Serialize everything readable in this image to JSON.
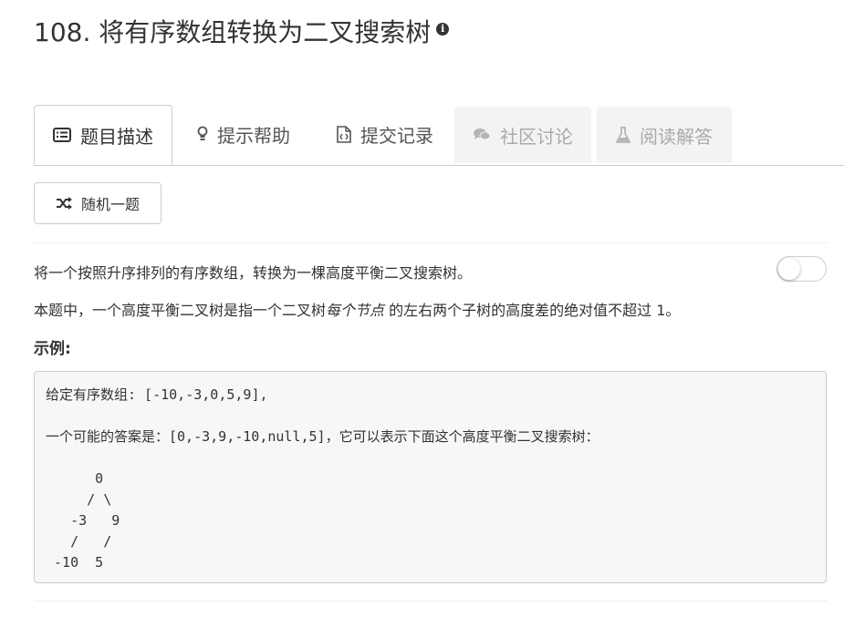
{
  "problem": {
    "title": "108. 将有序数组转换为二叉搜索树",
    "info_icon": "info-circle-icon"
  },
  "tabs": [
    {
      "label": "题目描述",
      "icon": "list-alt-icon",
      "state": "active"
    },
    {
      "label": "提示帮助",
      "icon": "lightbulb-icon",
      "state": "normal"
    },
    {
      "label": "提交记录",
      "icon": "file-code-icon",
      "state": "normal"
    },
    {
      "label": "社区讨论",
      "icon": "comments-icon",
      "state": "disabled"
    },
    {
      "label": "阅读解答",
      "icon": "flask-icon",
      "state": "disabled"
    }
  ],
  "random_button": {
    "label": "随机一题",
    "icon": "shuffle-icon"
  },
  "description": {
    "line1": "将一个按照升序排列的有序数组，转换为一棵高度平衡二叉搜索树。",
    "line2_prefix": "本题中，一个高度平衡二叉树是指一个二叉树",
    "line2_em": "每个节点",
    "line2_suffix": " 的左右两个子树的高度差的绝对值不超过 1。"
  },
  "toggle": {
    "on": false
  },
  "example": {
    "label": "示例:",
    "code": "给定有序数组: [-10,-3,0,5,9],\n\n一个可能的答案是：[0,-3,9,-10,null,5]，它可以表示下面这个高度平衡二叉搜索树：\n\n      0\n     / \\\n   -3   9\n   /   /\n -10  5"
  },
  "colors": {
    "text": "#333333",
    "border": "#cccccc",
    "disabled_tab_bg": "#f3f3f3",
    "code_bg": "#f7f7f7"
  }
}
